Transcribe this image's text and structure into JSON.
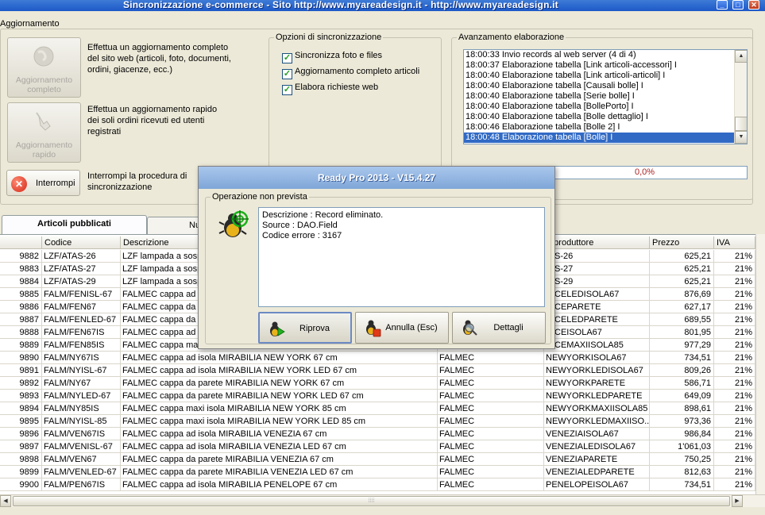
{
  "window": {
    "title": "Sincronizzazione e-commerce - Sito http://www.myareadesign.it - http://www.myareadesign.it"
  },
  "update": {
    "group_label": "Aggiornamento",
    "full_button": "Aggiornamento completo",
    "full_desc": "Effettua un aggiornamento completo del sito web (articoli, foto, documenti, ordini, giacenze, ecc.)",
    "quick_button": "Aggiornamento rapido",
    "quick_desc": "Effettua un aggiornamento rapido dei soli ordini ricevuti ed utenti registrati",
    "stop_button": "Interrompi",
    "stop_desc": "Interrompi la procedura di sincronizzazione"
  },
  "sync_options": {
    "label": "Opzioni di sincronizzazione",
    "items": [
      {
        "label": "Sincronizza foto e files",
        "checked": true
      },
      {
        "label": "Aggiornamento completo articoli",
        "checked": true
      },
      {
        "label": "Elabora richieste web",
        "checked": true
      }
    ]
  },
  "progress": {
    "label": "Avanzamento elaborazione",
    "log": [
      "18:00:33 Invio records al web server (4 di 4)",
      "18:00:37 Elaborazione tabella [Link articoli-accessori] I",
      "18:00:40 Elaborazione tabella [Link articoli-articoli] I",
      "18:00:40 Elaborazione tabella [Causali bolle] I",
      "18:00:40 Elaborazione tabella [Serie bolle] I",
      "18:00:40 Elaborazione tabella [BollePorto] I",
      "18:00:40 Elaborazione tabella [Bolle dettaglio] I",
      "18:00:46 Elaborazione tabella [Bolle 2] I",
      "18:00:48 Elaborazione tabella [Bolle] I"
    ],
    "selected_index": 8,
    "percent_text": "0,0%"
  },
  "tabs": [
    {
      "label": "Articoli pubblicati",
      "active": true
    },
    {
      "label": "Nu",
      "active": false
    }
  ],
  "grid": {
    "columns": [
      "",
      "Codice",
      "Descrizione",
      "",
      "d.produttore",
      "Prezzo",
      "IVA"
    ],
    "rows": [
      [
        "9882",
        "LZF/ATAS-26",
        "LZF lampada a sosp",
        "",
        "A-S-26",
        "625,21",
        "21%"
      ],
      [
        "9883",
        "LZF/ATAS-27",
        "LZF lampada a sosp",
        "",
        "A-S-27",
        "625,21",
        "21%"
      ],
      [
        "9884",
        "LZF/ATAS-29",
        "LZF lampada a sosp",
        "",
        "A-S-29",
        "625,21",
        "21%"
      ],
      [
        "9885",
        "FALM/FENISL-67",
        "FALMEC cappa ad is",
        "",
        "NICELEDISOLA67",
        "876,69",
        "21%"
      ],
      [
        "9886",
        "FALM/FEN67",
        "FALMEC cappa da p",
        "",
        "NICEPARETE",
        "627,17",
        "21%"
      ],
      [
        "9887",
        "FALM/FENLED-67",
        "FALMEC cappa da p",
        "",
        "NICELEDPARETE",
        "689,55",
        "21%"
      ],
      [
        "9888",
        "FALM/FEN67IS",
        "FALMEC cappa ad is",
        "",
        "NICEISOLA67",
        "801,95",
        "21%"
      ],
      [
        "9889",
        "FALM/FEN85IS",
        "FALMEC cappa maxi",
        "",
        "NICEMAXIISOLA85",
        "977,29",
        "21%"
      ],
      [
        "9890",
        "FALM/NY67IS",
        "FALMEC cappa ad isola MIRABILIA NEW YORK 67 cm",
        "FALMEC",
        "NEWYORKISOLA67",
        "734,51",
        "21%"
      ],
      [
        "9891",
        "FALM/NYISL-67",
        "FALMEC cappa ad isola MIRABILIA NEW YORK LED 67 cm",
        "FALMEC",
        "NEWYORKLEDISOLA67",
        "809,26",
        "21%"
      ],
      [
        "9892",
        "FALM/NY67",
        "FALMEC cappa da parete MIRABILIA NEW YORK 67 cm",
        "FALMEC",
        "NEWYORKPARETE",
        "586,71",
        "21%"
      ],
      [
        "9893",
        "FALM/NYLED-67",
        "FALMEC cappa da parete MIRABILIA NEW YORK LED 67 cm",
        "FALMEC",
        "NEWYORKLEDPARETE",
        "649,09",
        "21%"
      ],
      [
        "9894",
        "FALM/NY85IS",
        "FALMEC cappa maxi isola MIRABILIA NEW YORK 85 cm",
        "FALMEC",
        "NEWYORKMAXIISOLA85",
        "898,61",
        "21%"
      ],
      [
        "9895",
        "FALM/NYISL-85",
        "FALMEC cappa maxi isola MIRABILIA NEW YORK LED 85 cm",
        "FALMEC",
        "NEWYORKLEDMAXIISO...",
        "973,36",
        "21%"
      ],
      [
        "9896",
        "FALM/VEN67IS",
        "FALMEC cappa ad isola MIRABILIA VENEZIA 67 cm",
        "FALMEC",
        "VENEZIAISOLA67",
        "986,84",
        "21%"
      ],
      [
        "9897",
        "FALM/VENISL-67",
        "FALMEC cappa ad isola MIRABILIA VENEZIA LED 67 cm",
        "FALMEC",
        "VENEZIALEDISOLA67",
        "1'061,03",
        "21%"
      ],
      [
        "9898",
        "FALM/VEN67",
        "FALMEC cappa da parete MIRABILIA VENEZIA 67 cm",
        "FALMEC",
        "VENEZIAPARETE",
        "750,25",
        "21%"
      ],
      [
        "9899",
        "FALM/VENLED-67",
        "FALMEC cappa da parete MIRABILIA VENEZIA LED 67 cm",
        "FALMEC",
        "VENEZIALEDPARETE",
        "812,63",
        "21%"
      ],
      [
        "9900",
        "FALM/PEN67IS",
        "FALMEC cappa ad isola MIRABILIA PENELOPE 67 cm",
        "FALMEC",
        "PENELOPEISOLA67",
        "734,51",
        "21%"
      ]
    ]
  },
  "dialog": {
    "title": "Ready Pro 2013 - V15.4.27",
    "group_label": "Operazione non prevista",
    "message_lines": [
      "Descrizione : Record eliminato.",
      "Source : DAO.Field",
      "Codice errore : 3167"
    ],
    "retry_button": "Riprova",
    "cancel_button": "Annulla (Esc)",
    "details_button": "Dettagli"
  },
  "icons": {
    "close": "close-icon",
    "bug": "bug-target-icon"
  },
  "colors": {
    "selection": "#316ac5",
    "percent_text": "#aa2222"
  }
}
